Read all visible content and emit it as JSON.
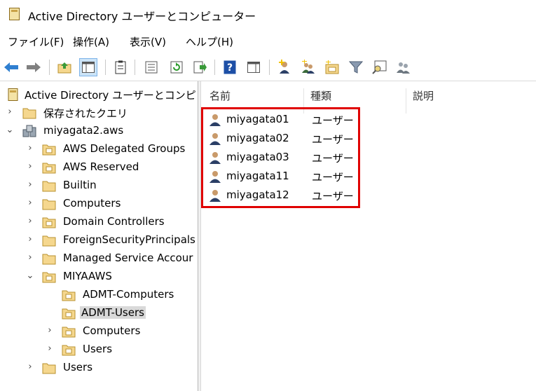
{
  "window": {
    "title": "Active Directory ユーザーとコンピューター"
  },
  "menu": [
    "ファイル(F)",
    "操作(A)",
    "表示(V)",
    "ヘルプ(H)"
  ],
  "toolbar_buttons": [
    "back-arrow-icon",
    "forward-arrow-icon",
    "up-folder-icon",
    "show-tree-icon",
    "clipboard-icon",
    "properties-icon",
    "refresh-icon",
    "export-list-icon",
    "help-icon",
    "action-pane-icon",
    "new-user-icon",
    "new-group-icon",
    "new-ou-icon",
    "filter-icon",
    "find-icon",
    "delegate-icon"
  ],
  "tree": {
    "root": "Active Directory ユーザーとコンピュー",
    "saved_queries": "保存されたクエリ",
    "domain": "miyagata2.aws",
    "children": [
      "AWS Delegated Groups",
      "AWS Reserved",
      "Builtin",
      "Computers",
      "Domain Controllers",
      "ForeignSecurityPrincipals",
      "Managed Service Accour",
      "MIYAAWS"
    ],
    "miyaaws_children": [
      "ADMT-Computers",
      "ADMT-Users",
      "Computers",
      "Users"
    ],
    "last": "Users",
    "selected": "ADMT-Users"
  },
  "list": {
    "columns": [
      "名前",
      "種類",
      "説明"
    ],
    "rows": [
      {
        "name": "miyagata01",
        "type": "ユーザー"
      },
      {
        "name": "miyagata02",
        "type": "ユーザー"
      },
      {
        "name": "miyagata03",
        "type": "ユーザー"
      },
      {
        "name": "miyagata11",
        "type": "ユーザー"
      },
      {
        "name": "miyagata12",
        "type": "ユーザー"
      }
    ]
  },
  "colors": {
    "highlight": "#e00000",
    "selection": "#d9d9d9",
    "folder": "#f5d78e"
  }
}
